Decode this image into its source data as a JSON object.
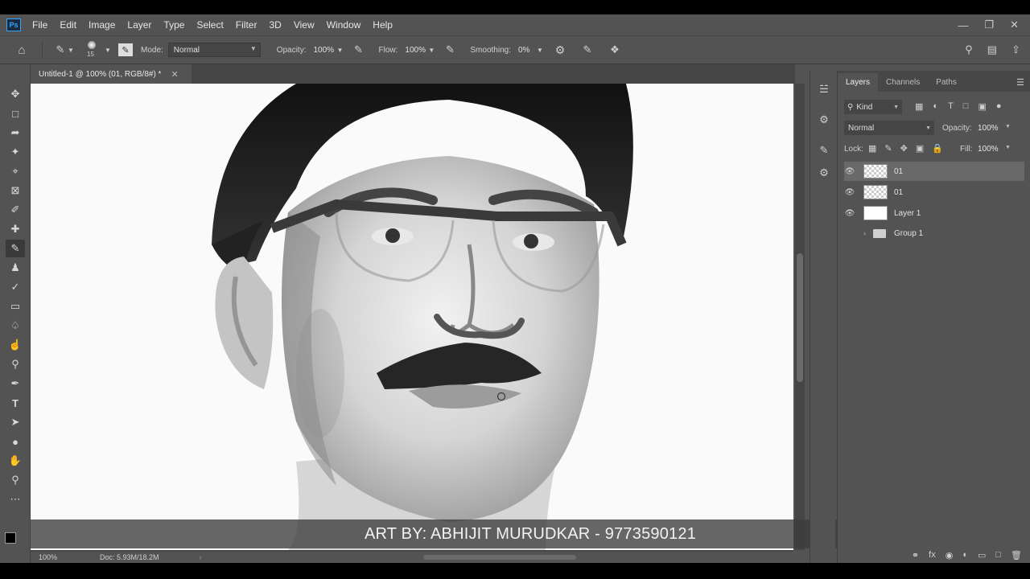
{
  "app": {
    "logo": "Ps"
  },
  "menu": [
    "File",
    "Edit",
    "Image",
    "Layer",
    "Type",
    "Select",
    "Filter",
    "3D",
    "View",
    "Window",
    "Help"
  ],
  "options": {
    "brush_size": "15",
    "mode_label": "Mode:",
    "mode_value": "Normal",
    "opacity_label": "Opacity:",
    "opacity_value": "100%",
    "flow_label": "Flow:",
    "flow_value": "100%",
    "smoothing_label": "Smoothing:",
    "smoothing_value": "0%"
  },
  "document": {
    "tab_title": "Untitled-1 @ 100% (01, RGB/8#) *"
  },
  "status": {
    "zoom": "100%",
    "doc_size": "Doc: 5.93M/18.2M"
  },
  "watermark": "ART BY: ABHIJIT MURUDKAR - 9773590121",
  "panel": {
    "tabs": [
      "Layers",
      "Channels",
      "Paths"
    ],
    "filter_kind": "Kind",
    "blend_mode": "Normal",
    "opacity_label": "Opacity:",
    "opacity_value": "100%",
    "lock_label": "Lock:",
    "fill_label": "Fill:",
    "fill_value": "100%",
    "layers": [
      {
        "name": "01",
        "visible": true,
        "selected": true
      },
      {
        "name": "01",
        "visible": true,
        "selected": false
      },
      {
        "name": "Layer 1",
        "visible": true,
        "selected": false
      },
      {
        "name": "Group 1",
        "visible": false,
        "selected": false
      }
    ]
  },
  "colors": {
    "ui_bg": "#535353",
    "panel_dark": "#454545",
    "accent": "#31a8ff"
  }
}
